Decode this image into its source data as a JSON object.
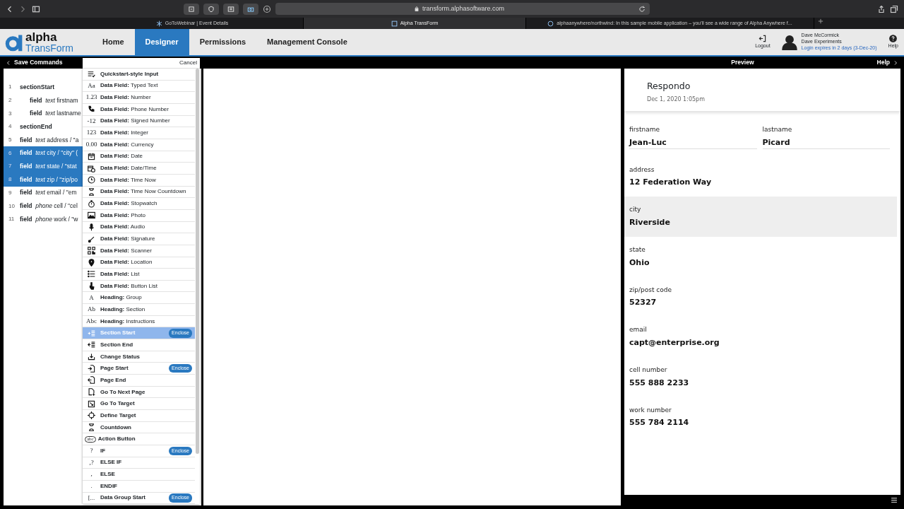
{
  "browser": {
    "url": "transform.alphasoftware.com",
    "tabs": [
      {
        "title": "GoToWebinar | Event Details",
        "selected": false
      },
      {
        "title": "Alpha TransForm",
        "selected": true
      },
      {
        "title": "alphaanywhere/northwind: In this sample mobile application – you'll see a wide range of Alpha Anywhere f...",
        "selected": false
      }
    ]
  },
  "app": {
    "logo_top": "alpha",
    "logo_bottom": "TransForm",
    "nav": [
      {
        "label": "Home",
        "selected": false
      },
      {
        "label": "Designer",
        "selected": true
      },
      {
        "label": "Permissions",
        "selected": false
      },
      {
        "label": "Management Console",
        "selected": false
      }
    ],
    "logout": "Logout",
    "user_name": "Dave McCormick",
    "user_org": "Dave Experiments",
    "login_expiry": "Login expires in 2 days (3-Dec-20)",
    "help": "Help"
  },
  "toolbar": {
    "save": "Save Commands",
    "cancel": "Cancel",
    "preview": "Preview",
    "help": "Help"
  },
  "code_lines": [
    {
      "num": "1",
      "keyword": "sectionStart",
      "selected": false,
      "children": [
        {
          "num": "2",
          "keyword": "field",
          "type": "text",
          "text": "firstnam",
          "selected": false
        },
        {
          "num": "3",
          "keyword": "field",
          "type": "text",
          "text": "lastname",
          "selected": false
        }
      ]
    },
    {
      "num": "4",
      "keyword": "sectionEnd",
      "selected": false
    },
    {
      "num": "5",
      "keyword": "field",
      "type": "text",
      "text": "address / \"a",
      "selected": false
    },
    {
      "num": "6",
      "keyword": "field",
      "type": "text",
      "text": "city / \"city\" (",
      "selected": true
    },
    {
      "num": "7",
      "keyword": "field",
      "type": "text",
      "text": "state / \"stat",
      "selected": true
    },
    {
      "num": "8",
      "keyword": "field",
      "type": "text",
      "text": "zip / \"zip/po",
      "selected": true
    },
    {
      "num": "9",
      "keyword": "field",
      "type": "text",
      "text": "email / \"em",
      "selected": false
    },
    {
      "num": "10",
      "keyword": "field",
      "type": "phone",
      "text": "cell / \"cel",
      "selected": false
    },
    {
      "num": "11",
      "keyword": "field",
      "type": "phone",
      "text": "work / \"w",
      "selected": false
    }
  ],
  "command_menu": [
    {
      "label": "Quickstart-style Input",
      "kind": "lines",
      "selected": false
    },
    {
      "label": "**Data Field:** Typed Text",
      "glyph": "Aa",
      "selected": false
    },
    {
      "label": "**Data Field:** Number",
      "glyph": "1.23",
      "selected": false
    },
    {
      "label": "**Data Field:** Phone Number",
      "kind": "phone",
      "selected": false
    },
    {
      "label": "**Data Field:** Signed Number",
      "glyph": "-12",
      "selected": false
    },
    {
      "label": "**Data Field:** Integer",
      "glyph": "123",
      "selected": false
    },
    {
      "label": "**Data Field:** Currency",
      "glyph": "0.00",
      "selected": false
    },
    {
      "label": "**Data Field:** Date",
      "kind": "calendar",
      "selected": false
    },
    {
      "label": "**Data Field:** Date/Time",
      "kind": "datetime",
      "selected": false
    },
    {
      "label": "**Data Field:** Time Now",
      "kind": "clock",
      "selected": false
    },
    {
      "label": "**Data Field:** Time Now Countdown",
      "kind": "hourglass",
      "selected": false
    },
    {
      "label": "**Data Field:** Stopwatch",
      "kind": "stopwatch",
      "selected": false
    },
    {
      "label": "**Data Field:** Photo",
      "kind": "photo",
      "selected": false
    },
    {
      "label": "**Data Field:** Audio",
      "kind": "mic",
      "selected": false
    },
    {
      "label": "**Data Field:** Signature",
      "kind": "pen",
      "selected": false
    },
    {
      "label": "**Data Field:** Scanner",
      "kind": "qr",
      "selected": false
    },
    {
      "label": "**Data Field:** Location",
      "kind": "pin",
      "selected": false
    },
    {
      "label": "**Data Field:** List",
      "kind": "bullets",
      "selected": false
    },
    {
      "label": "**Data Field:** Button List",
      "kind": "hand",
      "selected": false
    },
    {
      "label": "**Heading:** Group",
      "glyph": "A",
      "selected": false
    },
    {
      "label": "**Heading:** Section",
      "glyph": "Ab",
      "selected": false
    },
    {
      "label": "**Heading:** Instructions",
      "glyph": "Abc",
      "selected": false
    },
    {
      "label": "Section Start",
      "kind": "indent",
      "badge": "Enclose",
      "selected": true
    },
    {
      "label": "Section End",
      "kind": "outdent",
      "selected": false
    },
    {
      "label": "Change Status",
      "kind": "tray",
      "selected": false
    },
    {
      "label": "Page Start",
      "kind": "pagein",
      "badge": "Enclose",
      "selected": false
    },
    {
      "label": "Page End",
      "kind": "pageout",
      "selected": false
    },
    {
      "label": "Go To Next Page",
      "kind": "pageplus",
      "selected": false
    },
    {
      "label": "Go To Target",
      "kind": "gotarget",
      "selected": false
    },
    {
      "label": "Define Target",
      "kind": "crosshair",
      "selected": false
    },
    {
      "label": "Countdown",
      "kind": "hourglass",
      "selected": false
    },
    {
      "label": "Action Button",
      "glyph": "abc",
      "boxed": true,
      "selected": false
    },
    {
      "label": "IF",
      "glyph": "?",
      "badge": "Enclose",
      "selected": false
    },
    {
      "label": "ELSE IF",
      "glyph": ",?",
      "selected": false
    },
    {
      "label": "ELSE",
      "glyph": ",",
      "selected": false
    },
    {
      "label": "ENDIF",
      "glyph": ".",
      "selected": false
    },
    {
      "label": "Data Group Start",
      "glyph": "[...",
      "badge": "Enclose",
      "selected": false
    }
  ],
  "preview": {
    "title": "Respondo",
    "date": "Dec 1, 2020 1:05pm",
    "rows": [
      {
        "fields": [
          {
            "label": "firstname",
            "value": "Jean-Luc"
          },
          {
            "label": "lastname",
            "value": "Picard"
          }
        ],
        "selected": false
      },
      {
        "fields": [
          {
            "label": "address",
            "value": "12 Federation Way"
          }
        ],
        "selected": false
      },
      {
        "fields": [
          {
            "label": "city",
            "value": "Riverside"
          }
        ],
        "selected": true
      },
      {
        "fields": [
          {
            "label": "state",
            "value": "Ohio"
          }
        ],
        "selected": false
      },
      {
        "fields": [
          {
            "label": "zip/post code",
            "value": "52327"
          }
        ],
        "selected": false
      },
      {
        "fields": [
          {
            "label": "email",
            "value": "capt@enterprise.org"
          }
        ],
        "selected": false
      },
      {
        "fields": [
          {
            "label": "cell number",
            "value": "555 888 2233"
          }
        ],
        "selected": false
      },
      {
        "fields": [
          {
            "label": "work number",
            "value": "555 784 2114"
          }
        ],
        "selected": false
      }
    ]
  }
}
